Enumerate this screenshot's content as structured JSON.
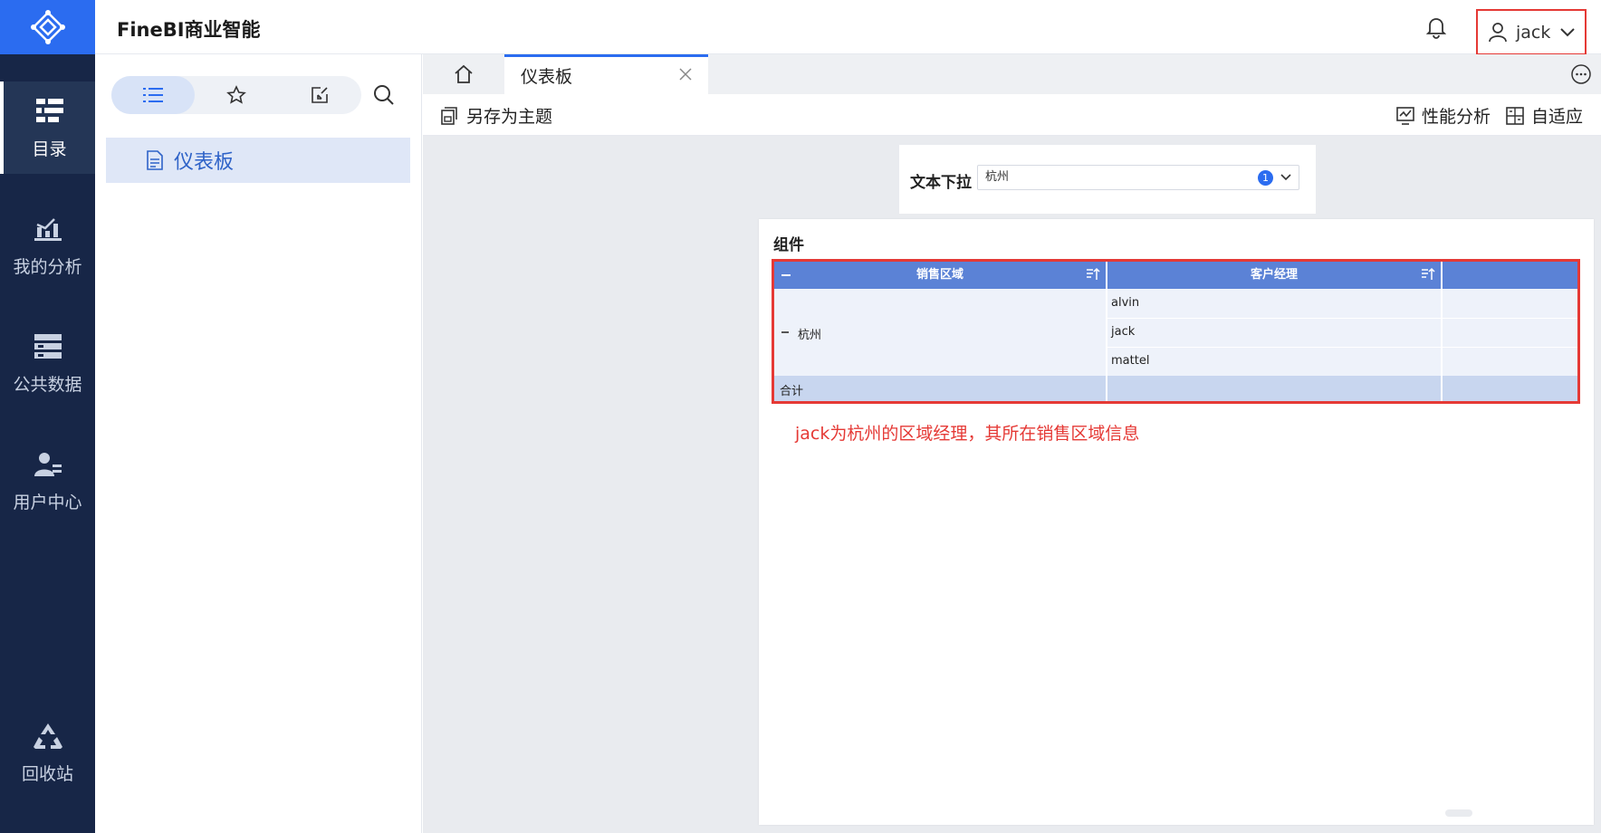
{
  "app": {
    "brand": "FineBI商业智能"
  },
  "nav": {
    "items": [
      {
        "label": "目录",
        "icon": "catalog-icon"
      },
      {
        "label": "我的分析",
        "icon": "analysis-icon"
      },
      {
        "label": "公共数据",
        "icon": "database-icon"
      },
      {
        "label": "用户中心",
        "icon": "user-center-icon"
      },
      {
        "label": "回收站",
        "icon": "recycle-icon"
      }
    ]
  },
  "header": {
    "username": "jack"
  },
  "side": {
    "tree": [
      {
        "label": "仪表板"
      }
    ]
  },
  "tabs": {
    "active": "仪表板"
  },
  "toolbar": {
    "save_theme": "另存为主题",
    "perf": "性能分析",
    "adaptive": "自适应"
  },
  "filter": {
    "label": "文本下拉",
    "value": "杭州",
    "count": "1"
  },
  "widget": {
    "title": "组件",
    "columns": [
      "销售区域",
      "客户经理"
    ],
    "region": "杭州",
    "managers": [
      "alvin",
      "jack",
      "mattel"
    ],
    "total_label": "合计"
  },
  "note": "jack为杭州的区域经理，其所在销售区域信息",
  "colors": {
    "nav_bg": "#172647",
    "accent": "#2b6cf0",
    "table_header": "#5b82d6",
    "highlight_red": "#e53935"
  }
}
